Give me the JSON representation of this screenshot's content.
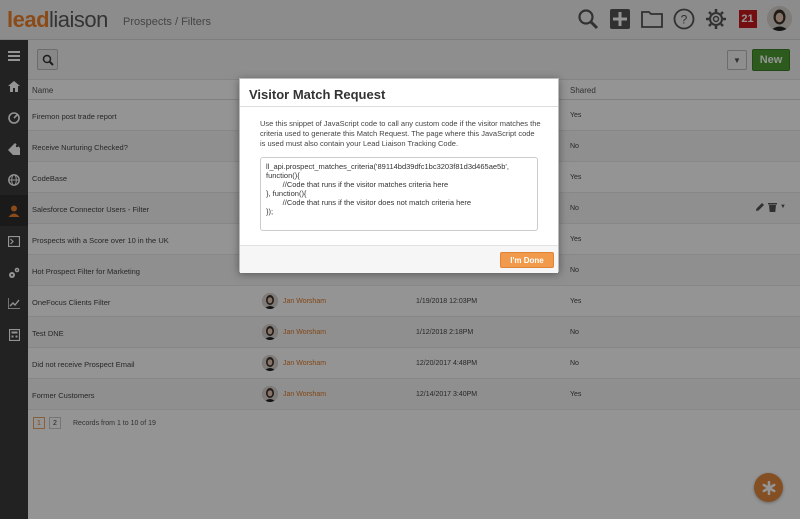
{
  "header": {
    "logo_lead": "lead",
    "logo_liaison": "liaison",
    "breadcrumb": "Prospects / Filters",
    "notification_count": "21",
    "icons": [
      "search-icon",
      "plus-icon",
      "folder-icon",
      "help-icon",
      "gear-icon",
      "calendar-icon",
      "avatar"
    ]
  },
  "sidebar": {
    "items": [
      "menu-icon",
      "home-icon",
      "dashboard-icon",
      "tag-icon",
      "globe-icon",
      "person-icon",
      "terminal-icon",
      "gears-icon",
      "chart-icon",
      "calculator-icon"
    ]
  },
  "toolbar": {
    "new_label": "New"
  },
  "table": {
    "columns": {
      "name": "Name",
      "shared": "Shared"
    },
    "rows": [
      {
        "name": "Firemon post trade report",
        "owner": "",
        "date": "",
        "shared": "Yes"
      },
      {
        "name": "Receive Nurturing Checked?",
        "owner": "",
        "date": "",
        "shared": "No"
      },
      {
        "name": "CodeBase",
        "owner": "",
        "date": "",
        "shared": "Yes"
      },
      {
        "name": "Salesforce Connector Users - Filter",
        "owner": "",
        "date": "",
        "shared": "No"
      },
      {
        "name": "Prospects with a Score over 10 in the UK",
        "owner": "",
        "date": "",
        "shared": "Yes"
      },
      {
        "name": "Hot Prospect Filter for Marketing",
        "owner": "",
        "date": "",
        "shared": "No"
      },
      {
        "name": "OneFocus Clients Filter",
        "owner": "Jan Worsham",
        "date": "1/19/2018 12:03PM",
        "shared": "Yes"
      },
      {
        "name": "Test DNE",
        "owner": "Jan Worsham",
        "date": "1/12/2018 2:18PM",
        "shared": "No"
      },
      {
        "name": "Did not receive Prospect Email",
        "owner": "Jan Worsham",
        "date": "12/20/2017 4:48PM",
        "shared": "No"
      },
      {
        "name": "Former Customers",
        "owner": "Jan Worsham",
        "date": "12/14/2017 3:40PM",
        "shared": "Yes"
      }
    ]
  },
  "pagination": {
    "pages": [
      "1",
      "2"
    ],
    "info": "Records from 1 to 10 of 19"
  },
  "modal": {
    "title": "Visitor Match Request",
    "description": "Use this snippet of JavaScript code to call any custom code if the visitor matches the criteria used to generate this Match Request. The page where this JavaScript code is used must also contain your Lead Liaison Tracking Code.",
    "code": "ll_api.prospect_matches_criteria('89114bd39dfc1bc3203f81d3d465ae5b',\nfunction(){\n        //Code that runs if the visitor matches criteria here\n}, function(){\n        //Code that runs if the visitor does not match criteria here\n});",
    "done_label": "I'm Done"
  }
}
